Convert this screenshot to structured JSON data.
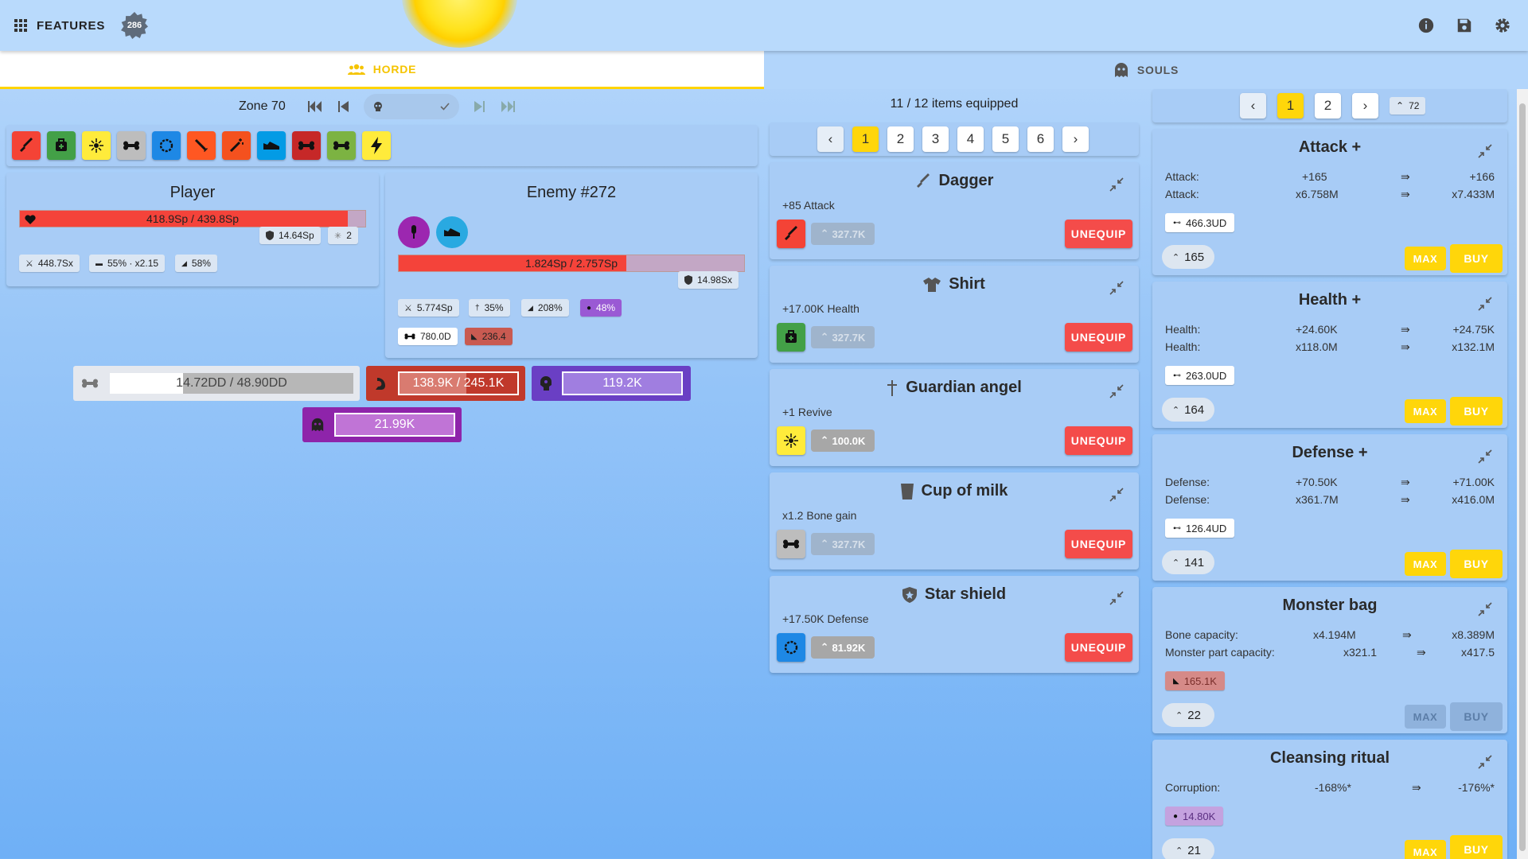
{
  "topbar": {
    "features_label": "FEATURES",
    "level_badge": "286"
  },
  "tabs": [
    {
      "label": "HORDE"
    },
    {
      "label": "SOULS"
    }
  ],
  "zone": {
    "label": "Zone 70"
  },
  "player": {
    "title": "Player",
    "health": "418.9Sp / 439.8Sp",
    "health_fraction": 0.95,
    "defense": "14.64Sp",
    "revives": "2",
    "attack": "448.7Sx",
    "crit": "55% · x2.15",
    "speed": "58%"
  },
  "enemy": {
    "title": "Enemy #272",
    "health": "1.824Sp / 2.757Sp",
    "health_fraction": 0.66,
    "defense": "14.98Sx",
    "attack": "5.774Sp",
    "stat2": "35%",
    "stat3": "208%",
    "stat4": "48%",
    "bones": "780.0D",
    "parts": "236.4"
  },
  "resources": {
    "bones": "14.72DD / 48.90DD",
    "bones_fraction": 0.3,
    "parts": "138.9K / 245.1K",
    "parts_fraction": 0.57,
    "corruption": "119.2K",
    "souls": "21.99K"
  },
  "equipment": {
    "count": "11 / 12 items equipped",
    "pages": [
      "1",
      "2",
      "3",
      "4",
      "5",
      "6"
    ],
    "unequip_label": "UNEQUIP",
    "items": [
      {
        "name": "Dagger",
        "desc": "+85 Attack",
        "level": "327.7K",
        "color": "#f44336"
      },
      {
        "name": "Shirt",
        "desc": "+17.00K Health",
        "level": "327.7K",
        "color": "#43a047"
      },
      {
        "name": "Guardian angel",
        "desc": "+1 Revive",
        "level": "100.0K",
        "color": "#ffeb3b"
      },
      {
        "name": "Cup of milk",
        "desc": "x1.2 Bone gain",
        "level": "327.7K",
        "color": "#bdbdbd"
      },
      {
        "name": "Star shield",
        "desc": "+17.50K Defense",
        "level": "81.92K",
        "color": "#1e88e5"
      }
    ]
  },
  "upgrades": {
    "pages": [
      "1",
      "2"
    ],
    "count": "72",
    "max_label": "MAX",
    "buy_label": "BUY",
    "cards": [
      {
        "title": "Attack +",
        "rows": [
          {
            "label": "Attack:",
            "from": "+165",
            "to": "+166"
          },
          {
            "label": "Attack:",
            "from": "x6.758M",
            "to": "x7.433M"
          }
        ],
        "cost": "466.3UD",
        "level": "165"
      },
      {
        "title": "Health +",
        "rows": [
          {
            "label": "Health:",
            "from": "+24.60K",
            "to": "+24.75K"
          },
          {
            "label": "Health:",
            "from": "x118.0M",
            "to": "x132.1M"
          }
        ],
        "cost": "263.0UD",
        "level": "164"
      },
      {
        "title": "Defense +",
        "rows": [
          {
            "label": "Defense:",
            "from": "+70.50K",
            "to": "+71.00K"
          },
          {
            "label": "Defense:",
            "from": "x361.7M",
            "to": "x416.0M"
          }
        ],
        "cost": "126.4UD",
        "level": "141"
      },
      {
        "title": "Monster bag",
        "rows": [
          {
            "label": "Bone capacity:",
            "from": "x4.194M",
            "to": "x8.389M"
          },
          {
            "label": "Monster part capacity:",
            "from": "x321.1",
            "to": "x417.5"
          }
        ],
        "cost": "165.1K",
        "level": "22"
      },
      {
        "title": "Cleansing ritual",
        "rows": [
          {
            "label": "Corruption:",
            "from": "-168%*",
            "to": "-176%*"
          }
        ],
        "cost": "14.80K",
        "level": "21"
      }
    ]
  }
}
